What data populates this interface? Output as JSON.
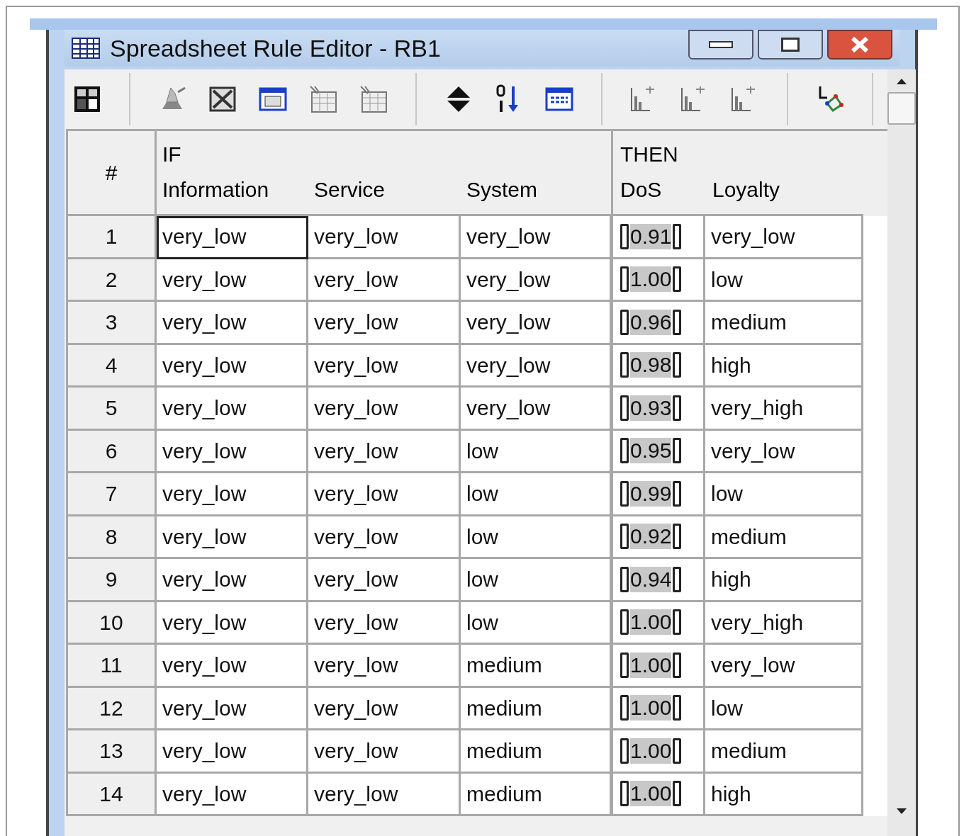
{
  "window": {
    "title": "Spreadsheet Rule Editor - RB1"
  },
  "toolbar": [
    {
      "kind": "grid"
    },
    {
      "kind": "sep"
    },
    {
      "kind": "wizard"
    },
    {
      "kind": "frame"
    },
    {
      "kind": "value"
    },
    {
      "kind": "table"
    },
    {
      "kind": "table"
    },
    {
      "kind": "sep"
    },
    {
      "kind": "updown"
    },
    {
      "kind": "sort"
    },
    {
      "kind": "calendar"
    },
    {
      "kind": "sep"
    },
    {
      "kind": "chart"
    },
    {
      "kind": "chart"
    },
    {
      "kind": "chart"
    },
    {
      "kind": "sep"
    },
    {
      "kind": "network"
    },
    {
      "kind": "sep"
    }
  ],
  "table": {
    "number_heading": "#",
    "if_heading": "IF",
    "then_heading": "THEN",
    "if_columns": [
      "Information",
      "Service",
      "System"
    ],
    "then_columns": [
      "DoS",
      "Loyalty"
    ],
    "rows": [
      {
        "number": "1",
        "if": [
          {
            "text": "very_low",
            "selected": true
          },
          {
            "text": "very_low",
            "selected": false
          },
          {
            "text": "very_low",
            "selected": false
          }
        ],
        "dos": "0.91",
        "loyalty": "very_low"
      },
      {
        "number": "2",
        "if": [
          {
            "text": "very_low",
            "selected": false
          },
          {
            "text": "very_low",
            "selected": false
          },
          {
            "text": "very_low",
            "selected": false
          }
        ],
        "dos": "1.00",
        "loyalty": "low"
      },
      {
        "number": "3",
        "if": [
          {
            "text": "very_low",
            "selected": false
          },
          {
            "text": "very_low",
            "selected": false
          },
          {
            "text": "very_low",
            "selected": false
          }
        ],
        "dos": "0.96",
        "loyalty": "medium"
      },
      {
        "number": "4",
        "if": [
          {
            "text": "very_low",
            "selected": false
          },
          {
            "text": "very_low",
            "selected": false
          },
          {
            "text": "very_low",
            "selected": false
          }
        ],
        "dos": "0.98",
        "loyalty": "high"
      },
      {
        "number": "5",
        "if": [
          {
            "text": "very_low",
            "selected": false
          },
          {
            "text": "very_low",
            "selected": false
          },
          {
            "text": "very_low",
            "selected": false
          }
        ],
        "dos": "0.93",
        "loyalty": "very_high"
      },
      {
        "number": "6",
        "if": [
          {
            "text": "very_low",
            "selected": false
          },
          {
            "text": "very_low",
            "selected": false
          },
          {
            "text": "low",
            "selected": false
          }
        ],
        "dos": "0.95",
        "loyalty": "very_low"
      },
      {
        "number": "7",
        "if": [
          {
            "text": "very_low",
            "selected": false
          },
          {
            "text": "very_low",
            "selected": false
          },
          {
            "text": "low",
            "selected": false
          }
        ],
        "dos": "0.99",
        "loyalty": "low"
      },
      {
        "number": "8",
        "if": [
          {
            "text": "very_low",
            "selected": false
          },
          {
            "text": "very_low",
            "selected": false
          },
          {
            "text": "low",
            "selected": false
          }
        ],
        "dos": "0.92",
        "loyalty": "medium"
      },
      {
        "number": "9",
        "if": [
          {
            "text": "very_low",
            "selected": false
          },
          {
            "text": "very_low",
            "selected": false
          },
          {
            "text": "low",
            "selected": false
          }
        ],
        "dos": "0.94",
        "loyalty": "high"
      },
      {
        "number": "10",
        "if": [
          {
            "text": "very_low",
            "selected": false
          },
          {
            "text": "very_low",
            "selected": false
          },
          {
            "text": "low",
            "selected": false
          }
        ],
        "dos": "1.00",
        "loyalty": "very_high"
      },
      {
        "number": "11",
        "if": [
          {
            "text": "very_low",
            "selected": false
          },
          {
            "text": "very_low",
            "selected": false
          },
          {
            "text": "medium",
            "selected": false
          }
        ],
        "dos": "1.00",
        "loyalty": "very_low"
      },
      {
        "number": "12",
        "if": [
          {
            "text": "very_low",
            "selected": false
          },
          {
            "text": "very_low",
            "selected": false
          },
          {
            "text": "medium",
            "selected": false
          }
        ],
        "dos": "1.00",
        "loyalty": "low"
      },
      {
        "number": "13",
        "if": [
          {
            "text": "very_low",
            "selected": false
          },
          {
            "text": "very_low",
            "selected": false
          },
          {
            "text": "medium",
            "selected": false
          }
        ],
        "dos": "1.00",
        "loyalty": "medium"
      },
      {
        "number": "14",
        "if": [
          {
            "text": "very_low",
            "selected": false
          },
          {
            "text": "very_low",
            "selected": false
          },
          {
            "text": "medium",
            "selected": false
          }
        ],
        "dos": "1.00",
        "loyalty": "high"
      }
    ]
  }
}
